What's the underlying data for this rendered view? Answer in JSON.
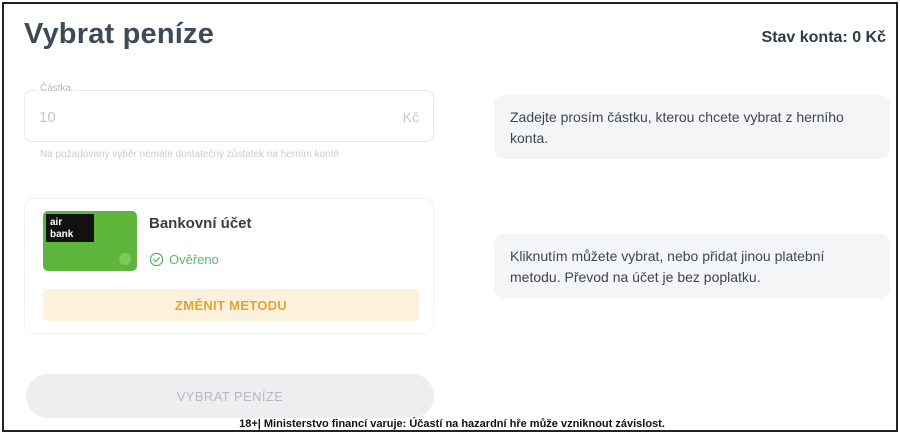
{
  "header": {
    "title": "Vybrat peníze",
    "balance": "Stav konta: 0 Kč"
  },
  "amount": {
    "legend": "Částka",
    "value": "10",
    "currency": "Kč",
    "error": "Na požadovaný výběr nemáte dostatečný zůstatek na herním kontě"
  },
  "info": {
    "amount_hint": "Zadejte prosím částku, kterou chcete vybrat z herního konta.",
    "method_hint": "Kliknutím můžete vybrat, nebo přidat jinou platební metodu. Převod na účet je bez poplatku."
  },
  "method": {
    "card_logo_line1": "air",
    "card_logo_line2": "bank",
    "name": "Bankovní účet",
    "status": "Ověřeno",
    "change_label": "ZMĚNIT METODU"
  },
  "actions": {
    "withdraw_label": "VYBRAT PENÍZE"
  },
  "footer": {
    "disclaimer": "18+| Ministerstvo financí varuje: Účastí na hazardní hře může vzniknout závislost."
  },
  "colors": {
    "accent_orange": "#e0a532",
    "verified_green": "#59b96a",
    "card_green": "#5fb43c"
  }
}
